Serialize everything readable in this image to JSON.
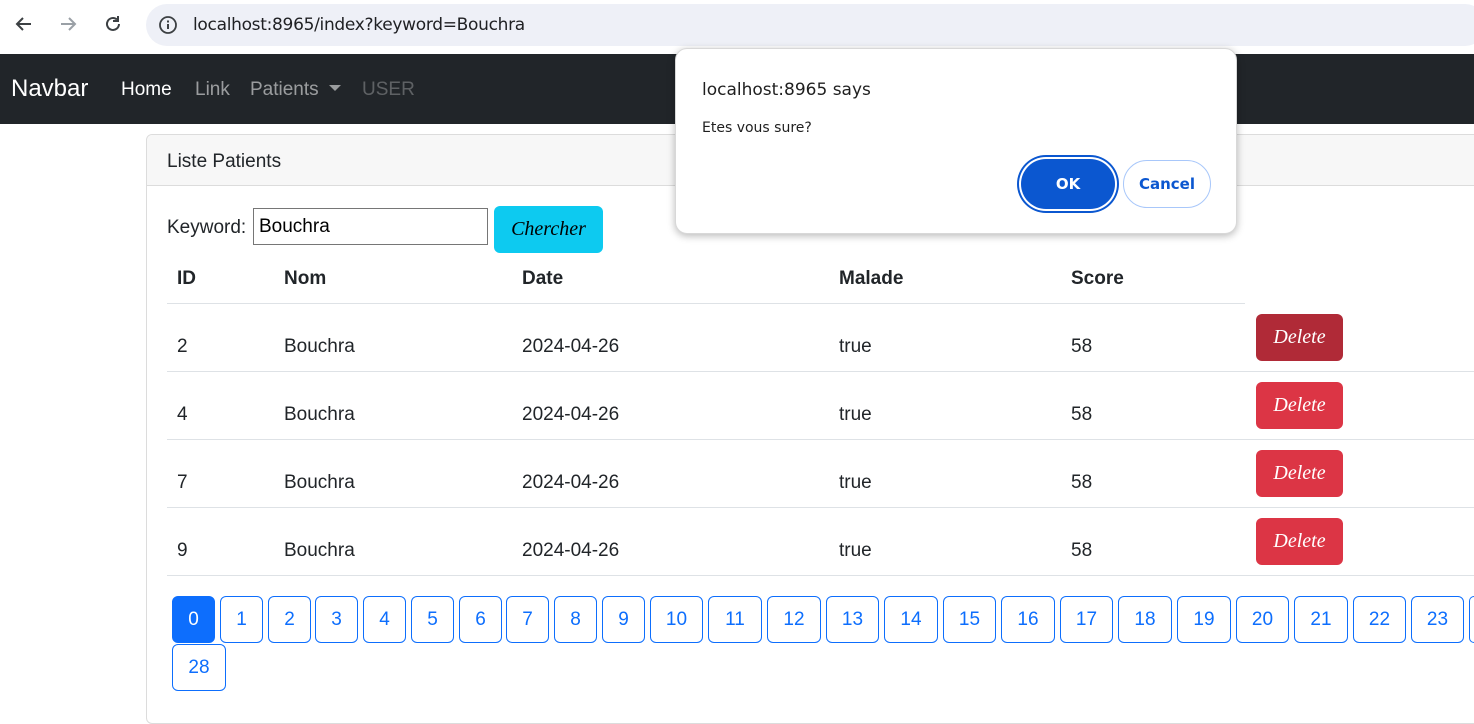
{
  "browser": {
    "url": "localhost:8965/index?keyword=Bouchra"
  },
  "navbar": {
    "brand": "Navbar",
    "links": [
      "Home",
      "Link",
      "Patients",
      "USER"
    ]
  },
  "card": {
    "title": "Liste Patients"
  },
  "search": {
    "label": "Keyword:",
    "value": "Bouchra",
    "button": "Chercher"
  },
  "table": {
    "headers": [
      "ID",
      "Nom",
      "Date",
      "Malade",
      "Score"
    ],
    "rows": [
      {
        "id": "2",
        "nom": "Bouchra",
        "date": "2024-04-26",
        "malade": "true",
        "score": "58",
        "action": "Delete"
      },
      {
        "id": "4",
        "nom": "Bouchra",
        "date": "2024-04-26",
        "malade": "true",
        "score": "58",
        "action": "Delete"
      },
      {
        "id": "7",
        "nom": "Bouchra",
        "date": "2024-04-26",
        "malade": "true",
        "score": "58",
        "action": "Delete"
      },
      {
        "id": "9",
        "nom": "Bouchra",
        "date": "2024-04-26",
        "malade": "true",
        "score": "58",
        "action": "Delete"
      }
    ]
  },
  "pagination": {
    "pages": [
      "0",
      "1",
      "2",
      "3",
      "4",
      "5",
      "6",
      "7",
      "8",
      "9",
      "10",
      "11",
      "12",
      "13",
      "14",
      "15",
      "16",
      "17",
      "18",
      "19",
      "20",
      "21",
      "22",
      "23",
      "28"
    ],
    "current": "0"
  },
  "dialog": {
    "title": "localhost:8965 says",
    "message": "Etes vous sure?",
    "ok": "OK",
    "cancel": "Cancel"
  },
  "colors": {
    "navbar_bg": "#212529",
    "info_button": "#0dcaf0",
    "danger": "#dc3545",
    "primary": "#0d6efd",
    "dialog_primary": "#0b57d0"
  }
}
